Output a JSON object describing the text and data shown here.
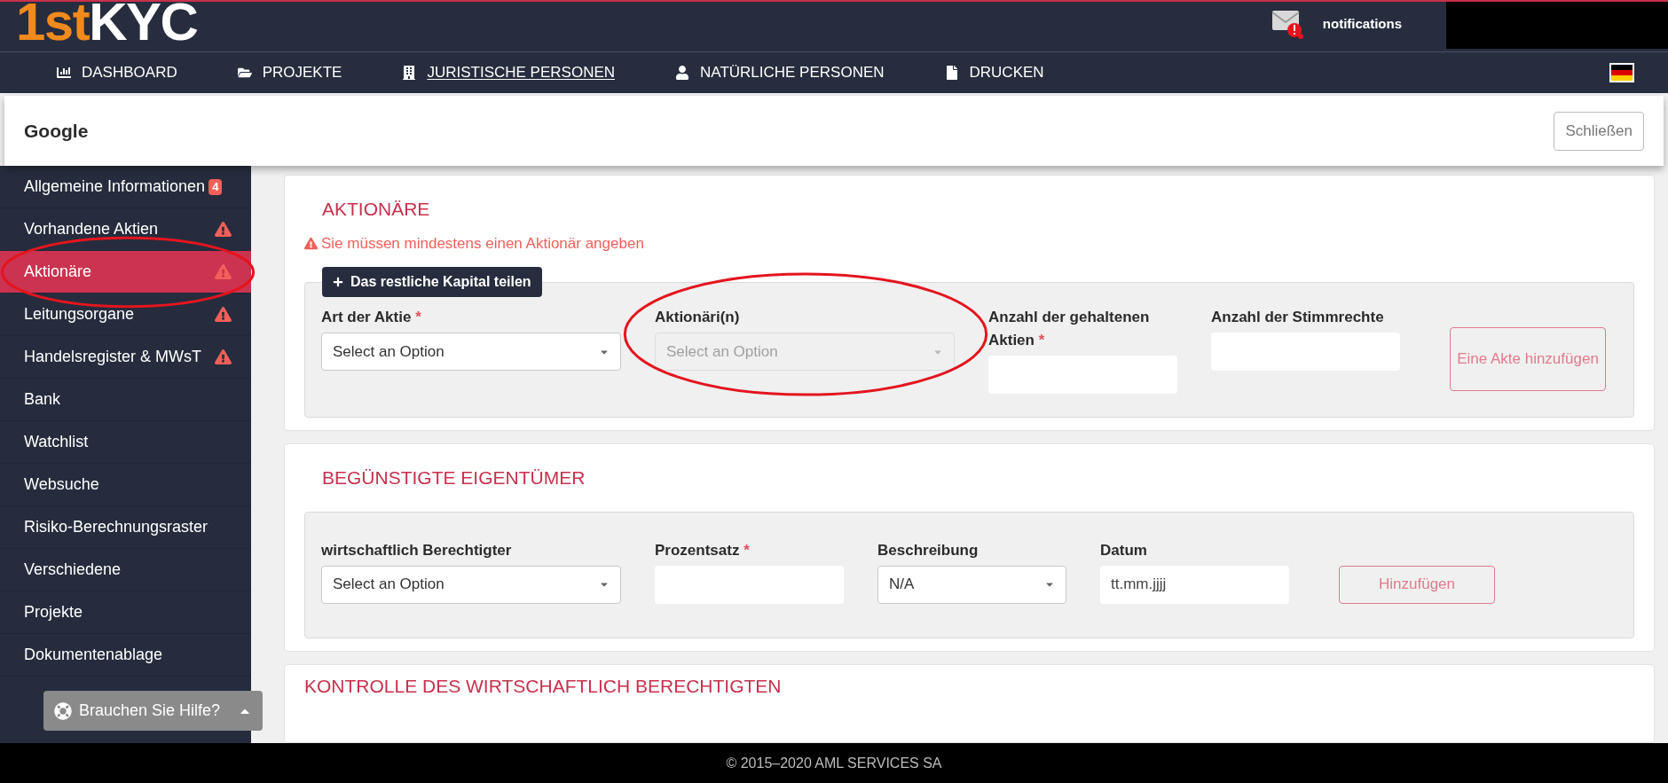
{
  "logo": {
    "part_1": "1st",
    "part_2": "KYC"
  },
  "notifications": {
    "label": "notifications",
    "unread": true
  },
  "nav": [
    {
      "label": "DASHBOARD",
      "selected": false
    },
    {
      "label": "PROJEKTE",
      "selected": false
    },
    {
      "label": "JURISTISCHE PERSONEN",
      "selected": true
    },
    {
      "label": "NATÜRLICHE PERSONEN",
      "selected": false
    },
    {
      "label": "DRUCKEN",
      "selected": false
    }
  ],
  "modal": {
    "title": "Google",
    "close_button": "Schließen"
  },
  "sidebar": [
    {
      "label": "Allgemeine Informationen",
      "badge": "4",
      "warning": false,
      "selected": false,
      "circled": false
    },
    {
      "label": "Vorhandene Aktien",
      "warning": true,
      "selected": false,
      "circled": false
    },
    {
      "label": "Aktionäre",
      "warning": true,
      "selected": true,
      "circled": true
    },
    {
      "label": "Leitungsorgane",
      "warning": true,
      "selected": false,
      "circled": false
    },
    {
      "label": "Handelsregister & MWsT",
      "warning": true,
      "selected": false,
      "circled": false
    },
    {
      "label": "Bank",
      "warning": false,
      "selected": false,
      "circled": false
    },
    {
      "label": "Watchlist",
      "warning": false,
      "selected": false,
      "circled": false
    },
    {
      "label": "Websuche",
      "warning": false,
      "selected": false,
      "circled": false
    },
    {
      "label": "Risiko-Berechnungsraster",
      "warning": false,
      "selected": false,
      "circled": false
    },
    {
      "label": "Verschiedene",
      "warning": false,
      "selected": false,
      "circled": false
    },
    {
      "label": "Projekte",
      "warning": false,
      "selected": false,
      "circled": false
    },
    {
      "label": "Dokumentenablage",
      "warning": false,
      "selected": false,
      "circled": false
    }
  ],
  "help_button": "Brauchen Sie Hilfe?",
  "shareholders": {
    "title": "AKTIONÄRE",
    "error": "Sie müssen mindestens einen Aktionär angeben",
    "split_button": "Das restliche Kapital teilen",
    "fields": [
      {
        "kind": "select",
        "label": "Art der Aktie",
        "required_mark": "*",
        "placeholder": "Select an Option",
        "disabled": false,
        "circled": false
      },
      {
        "kind": "select",
        "label": "Aktionäri(n)",
        "placeholder": "Select an Option",
        "disabled": true,
        "circled": true
      },
      {
        "kind": "input",
        "label": "Anzahl der gehaltenen Aktien",
        "required_mark": "*",
        "circled": false
      },
      {
        "kind": "input",
        "label": "Anzahl der Stimmrechte",
        "circled": false
      }
    ],
    "add_button": "Eine Akte hinzufügen"
  },
  "beneficial_owners": {
    "title": "BEGÜNSTIGTE EIGENTÜMER",
    "fields": [
      {
        "kind": "select",
        "label": "wirtschaftlich Berechtigter",
        "placeholder": "Select an Option",
        "disabled": false,
        "circled": false
      },
      {
        "kind": "input",
        "label": "Prozentsatz",
        "required_mark": "*",
        "circled": false
      },
      {
        "kind": "select",
        "label": "Beschreibung",
        "value": "N/A",
        "disabled": false,
        "circled": false
      },
      {
        "kind": "input",
        "label": "Datum",
        "placeholder": "tt.mm.jjjj",
        "circled": false
      }
    ],
    "add_button": "Hinzufügen"
  },
  "control_section": {
    "title": "KONTROLLE DES WIRTSCHAFTLICH BERECHTIGTEN"
  },
  "footer": "© 2015–2020 AML SERVICES SA"
}
